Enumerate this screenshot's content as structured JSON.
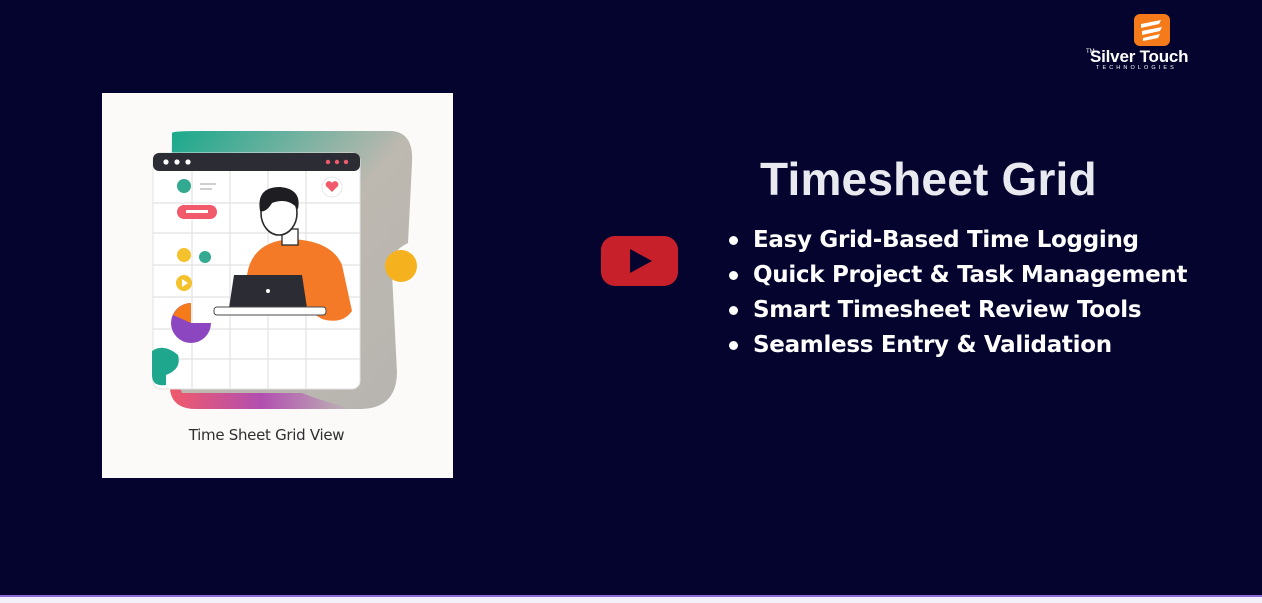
{
  "logo": {
    "name": "Silver Touch",
    "trademark": "TM",
    "subtitle": "TECHNOLOGIES",
    "accent": "#f47a1a"
  },
  "thumbnail": {
    "caption": "Time Sheet Grid View",
    "icon": "person-laptop-grid-illustration"
  },
  "video": {
    "play_icon": "youtube-play-icon",
    "color": "#c8202b"
  },
  "content": {
    "title": "Timesheet Grid",
    "bullets": [
      "Easy Grid-Based Time Logging",
      "Quick Project & Task Management",
      "Smart Timesheet Review Tools",
      "Seamless Entry & Validation"
    ]
  },
  "colors": {
    "background": "#04042e",
    "text": "#ffffff"
  }
}
